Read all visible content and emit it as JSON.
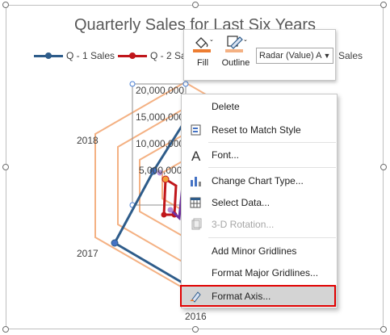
{
  "chart": {
    "title": "Quarterly Sales for Last Six Years",
    "legend": [
      {
        "label": "Q - 1 Sales",
        "color": "#2e5c8a"
      },
      {
        "label": "Q - 2 Sa",
        "color": "#c0161b"
      },
      {
        "label": "Sales"
      }
    ],
    "axis_ticks": [
      "20,000,000",
      "15,000,000",
      "10,000,000",
      "5,000,000"
    ],
    "categories": [
      "2018",
      "2017",
      "2016"
    ]
  },
  "mini_toolbar": {
    "fill_label": "Fill",
    "outline_label": "Outline",
    "element_selector": "Radar (Value) A"
  },
  "context_menu": {
    "items": [
      {
        "label": "Delete",
        "icon": "none",
        "enabled": true
      },
      {
        "label": "Reset to Match Style",
        "icon": "reset-style-icon",
        "enabled": true
      },
      {
        "label": "Font...",
        "icon": "font-icon",
        "enabled": true
      },
      {
        "label": "Change Chart Type...",
        "icon": "chart-type-icon",
        "enabled": true
      },
      {
        "label": "Select Data...",
        "icon": "select-data-icon",
        "enabled": true
      },
      {
        "label": "3-D Rotation...",
        "icon": "rotation-icon",
        "enabled": false
      },
      {
        "label": "Add Minor Gridlines",
        "icon": "none",
        "enabled": true
      },
      {
        "label": "Format Major Gridlines...",
        "icon": "none",
        "enabled": true
      },
      {
        "label": "Format Axis...",
        "icon": "format-axis-icon",
        "enabled": true,
        "highlighted": true
      }
    ]
  }
}
